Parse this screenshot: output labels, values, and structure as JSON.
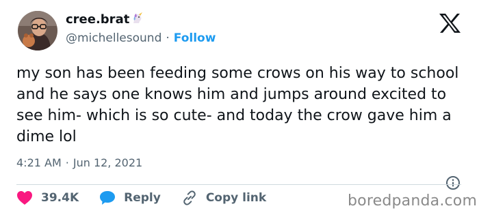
{
  "author": {
    "display_name": "cree.brat",
    "badge_icon": "unicorn-icon",
    "handle": "@michellesound",
    "separator": "·",
    "follow_label": "Follow"
  },
  "tweet": {
    "text": "my son has been feeding some crows on his way to school and he says one knows him and jumps around excited to see him- which is so cute- and today the crow gave him a dime lol",
    "time": "4:21 AM",
    "date": "Jun 12, 2021",
    "separator": "·"
  },
  "actions": {
    "like_count": "39.4K",
    "reply_label": "Reply",
    "copy_link_label": "Copy link"
  },
  "watermark": "boredpanda.com",
  "colors": {
    "accent": "#1d9bf0",
    "like": "#f91880",
    "secondary_text": "#536471",
    "text": "#0f1419"
  }
}
